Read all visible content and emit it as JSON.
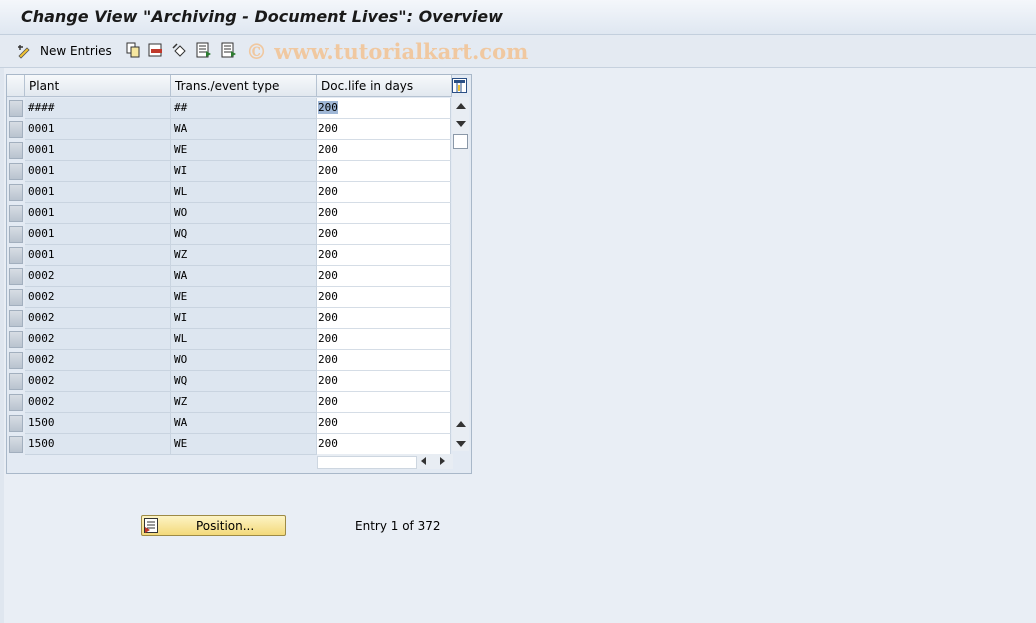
{
  "window": {
    "title": "Change View \"Archiving - Document Lives\": Overview"
  },
  "toolbar": {
    "new_entries_label": "New Entries",
    "icons": [
      "change-icon",
      "copy-icon",
      "delete-icon",
      "undo-icon",
      "select-all-icon",
      "deselect-icon"
    ],
    "watermark": "© www.tutorialkart.com"
  },
  "table": {
    "columns": [
      "Plant",
      "Trans./event type",
      "Doc.life in days"
    ],
    "rows": [
      [
        "####",
        "##",
        "200"
      ],
      [
        "0001",
        "WA",
        "200"
      ],
      [
        "0001",
        "WE",
        "200"
      ],
      [
        "0001",
        "WI",
        "200"
      ],
      [
        "0001",
        "WL",
        "200"
      ],
      [
        "0001",
        "WO",
        "200"
      ],
      [
        "0001",
        "WQ",
        "200"
      ],
      [
        "0001",
        "WZ",
        "200"
      ],
      [
        "0002",
        "WA",
        "200"
      ],
      [
        "0002",
        "WE",
        "200"
      ],
      [
        "0002",
        "WI",
        "200"
      ],
      [
        "0002",
        "WL",
        "200"
      ],
      [
        "0002",
        "WO",
        "200"
      ],
      [
        "0002",
        "WQ",
        "200"
      ],
      [
        "0002",
        "WZ",
        "200"
      ],
      [
        "1500",
        "WA",
        "200"
      ],
      [
        "1500",
        "WE",
        "200"
      ]
    ]
  },
  "footer": {
    "position_button": "Position...",
    "entry_info": "Entry 1 of 372"
  },
  "colors": {
    "accent_button": "#f3d97a",
    "table_key_bg": "#dde6f0",
    "highlight": "#9fb7d6"
  }
}
